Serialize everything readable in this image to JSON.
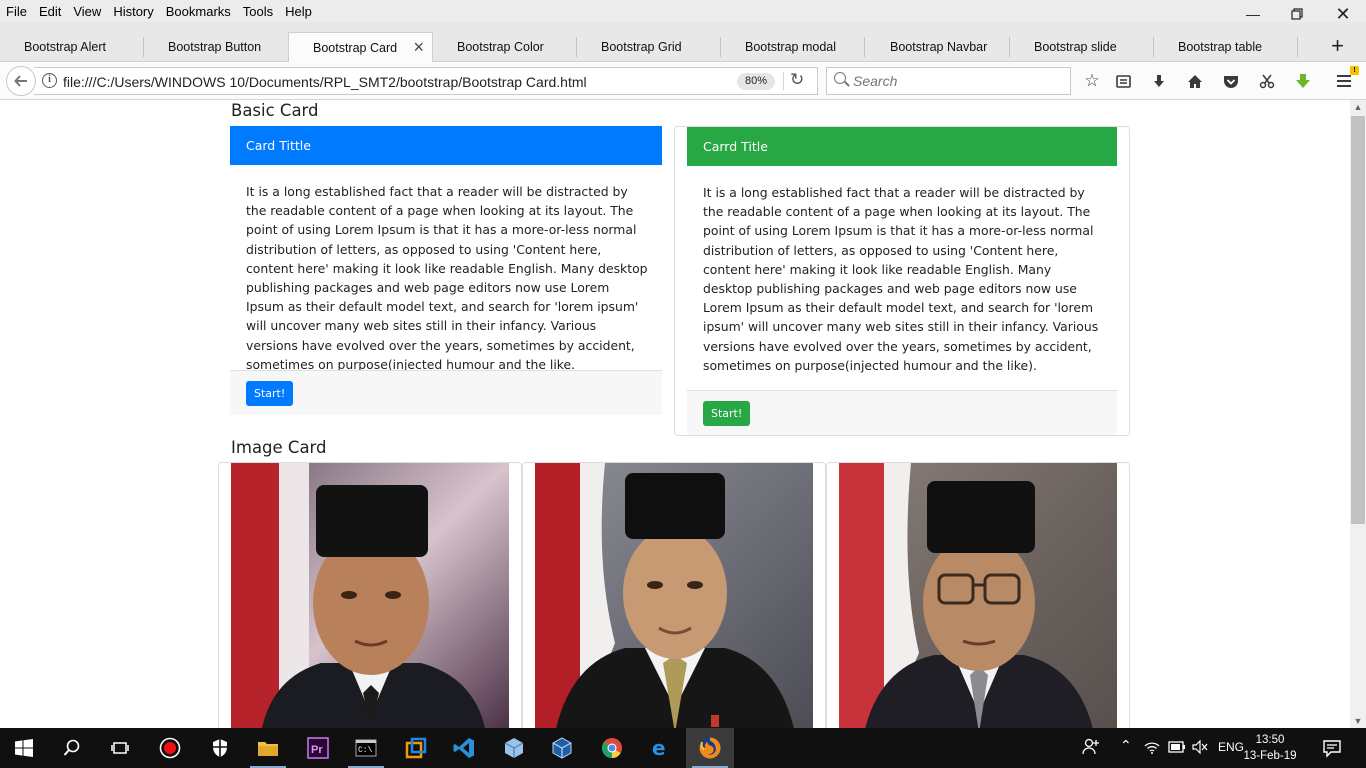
{
  "menu": [
    "File",
    "Edit",
    "View",
    "History",
    "Bookmarks",
    "Tools",
    "Help"
  ],
  "tabs": [
    {
      "label": "Bootstrap Alert",
      "active": false
    },
    {
      "label": "Bootstrap Button",
      "active": false
    },
    {
      "label": "Bootstrap Card",
      "active": true
    },
    {
      "label": "Bootstrap Color",
      "active": false
    },
    {
      "label": "Bootstrap Grid",
      "active": false
    },
    {
      "label": "Bootstrap modal",
      "active": false
    },
    {
      "label": "Bootstrap Navbar",
      "active": false
    },
    {
      "label": "Bootstrap slide",
      "active": false
    },
    {
      "label": "Bootstrap table",
      "active": false
    }
  ],
  "nav": {
    "url": "file:///C:/Users/WINDOWS 10/Documents/RPL_SMT2/bootstrap/Bootstrap Card.html",
    "zoom": "80%",
    "search_placeholder": "Search"
  },
  "page": {
    "basic_title": "Basic Card",
    "image_title": "Image Card",
    "card1": {
      "header": "Card Tittle",
      "body": "It is a long established fact that a reader will be distracted by the readable content of a page when looking at its layout. The point of using Lorem Ipsum is that it has a more-or-less normal distribution of letters, as opposed to using 'Content here, content here' making it look like readable English. Many desktop publishing packages and web page editors now use Lorem Ipsum as their default model text, and search for 'lorem ipsum' will uncover many web sites still in their infancy. Various versions have evolved over the years, sometimes by accident, sometimes on purpose(injected humour and the like.",
      "button": "Start!",
      "color": "#007bff"
    },
    "card2": {
      "header": "Carrd Title",
      "body": "It is a long established fact that a reader will be distracted by the readable content of a page when looking at its layout. The point of using Lorem Ipsum is that it has a more-or-less normal distribution of letters, as opposed to using 'Content here, content here' making it look like readable English. Many desktop publishing packages and web page editors now use Lorem Ipsum as their default model text, and search for 'lorem ipsum' will uncover many web sites still in their infancy. Various versions have evolved over the years, sometimes by accident, sometimes on purpose(injected humour and the like).",
      "button": "Start!",
      "color": "#28a745"
    }
  },
  "taskbar": {
    "apps": [
      "start-icon",
      "search-icon",
      "task-view-icon",
      "record-icon",
      "shield-icon",
      "file-explorer-icon",
      "premiere-icon",
      "terminal-icon",
      "app-icon",
      "vscode-icon",
      "box-icon",
      "virtualbox-icon",
      "chrome-icon",
      "edge-icon",
      "firefox-icon"
    ],
    "language": "ENG",
    "time": "13:50",
    "date": "13-Feb-19"
  }
}
